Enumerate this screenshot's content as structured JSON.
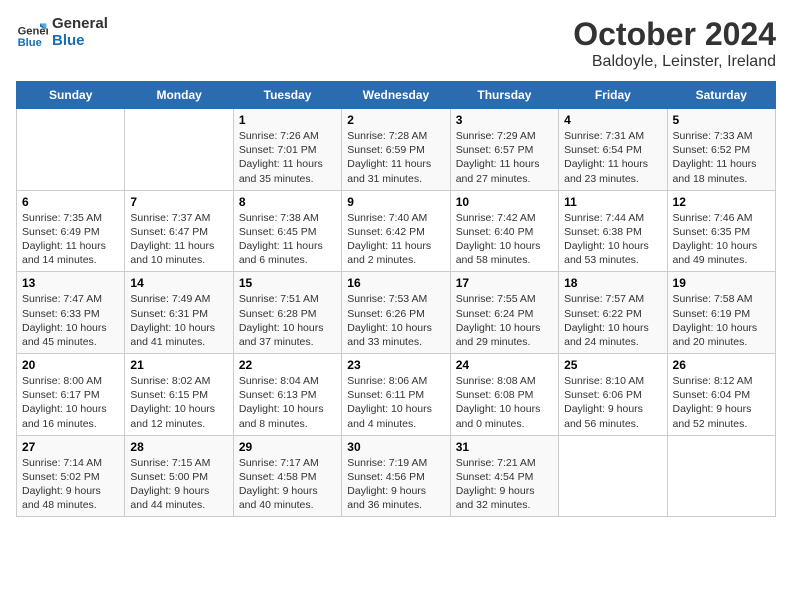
{
  "logo": {
    "line1": "General",
    "line2": "Blue"
  },
  "title": "October 2024",
  "subtitle": "Baldoyle, Leinster, Ireland",
  "headers": [
    "Sunday",
    "Monday",
    "Tuesday",
    "Wednesday",
    "Thursday",
    "Friday",
    "Saturday"
  ],
  "weeks": [
    [
      {
        "day": "",
        "detail": ""
      },
      {
        "day": "",
        "detail": ""
      },
      {
        "day": "1",
        "detail": "Sunrise: 7:26 AM\nSunset: 7:01 PM\nDaylight: 11 hours and 35 minutes."
      },
      {
        "day": "2",
        "detail": "Sunrise: 7:28 AM\nSunset: 6:59 PM\nDaylight: 11 hours and 31 minutes."
      },
      {
        "day": "3",
        "detail": "Sunrise: 7:29 AM\nSunset: 6:57 PM\nDaylight: 11 hours and 27 minutes."
      },
      {
        "day": "4",
        "detail": "Sunrise: 7:31 AM\nSunset: 6:54 PM\nDaylight: 11 hours and 23 minutes."
      },
      {
        "day": "5",
        "detail": "Sunrise: 7:33 AM\nSunset: 6:52 PM\nDaylight: 11 hours and 18 minutes."
      }
    ],
    [
      {
        "day": "6",
        "detail": "Sunrise: 7:35 AM\nSunset: 6:49 PM\nDaylight: 11 hours and 14 minutes."
      },
      {
        "day": "7",
        "detail": "Sunrise: 7:37 AM\nSunset: 6:47 PM\nDaylight: 11 hours and 10 minutes."
      },
      {
        "day": "8",
        "detail": "Sunrise: 7:38 AM\nSunset: 6:45 PM\nDaylight: 11 hours and 6 minutes."
      },
      {
        "day": "9",
        "detail": "Sunrise: 7:40 AM\nSunset: 6:42 PM\nDaylight: 11 hours and 2 minutes."
      },
      {
        "day": "10",
        "detail": "Sunrise: 7:42 AM\nSunset: 6:40 PM\nDaylight: 10 hours and 58 minutes."
      },
      {
        "day": "11",
        "detail": "Sunrise: 7:44 AM\nSunset: 6:38 PM\nDaylight: 10 hours and 53 minutes."
      },
      {
        "day": "12",
        "detail": "Sunrise: 7:46 AM\nSunset: 6:35 PM\nDaylight: 10 hours and 49 minutes."
      }
    ],
    [
      {
        "day": "13",
        "detail": "Sunrise: 7:47 AM\nSunset: 6:33 PM\nDaylight: 10 hours and 45 minutes."
      },
      {
        "day": "14",
        "detail": "Sunrise: 7:49 AM\nSunset: 6:31 PM\nDaylight: 10 hours and 41 minutes."
      },
      {
        "day": "15",
        "detail": "Sunrise: 7:51 AM\nSunset: 6:28 PM\nDaylight: 10 hours and 37 minutes."
      },
      {
        "day": "16",
        "detail": "Sunrise: 7:53 AM\nSunset: 6:26 PM\nDaylight: 10 hours and 33 minutes."
      },
      {
        "day": "17",
        "detail": "Sunrise: 7:55 AM\nSunset: 6:24 PM\nDaylight: 10 hours and 29 minutes."
      },
      {
        "day": "18",
        "detail": "Sunrise: 7:57 AM\nSunset: 6:22 PM\nDaylight: 10 hours and 24 minutes."
      },
      {
        "day": "19",
        "detail": "Sunrise: 7:58 AM\nSunset: 6:19 PM\nDaylight: 10 hours and 20 minutes."
      }
    ],
    [
      {
        "day": "20",
        "detail": "Sunrise: 8:00 AM\nSunset: 6:17 PM\nDaylight: 10 hours and 16 minutes."
      },
      {
        "day": "21",
        "detail": "Sunrise: 8:02 AM\nSunset: 6:15 PM\nDaylight: 10 hours and 12 minutes."
      },
      {
        "day": "22",
        "detail": "Sunrise: 8:04 AM\nSunset: 6:13 PM\nDaylight: 10 hours and 8 minutes."
      },
      {
        "day": "23",
        "detail": "Sunrise: 8:06 AM\nSunset: 6:11 PM\nDaylight: 10 hours and 4 minutes."
      },
      {
        "day": "24",
        "detail": "Sunrise: 8:08 AM\nSunset: 6:08 PM\nDaylight: 10 hours and 0 minutes."
      },
      {
        "day": "25",
        "detail": "Sunrise: 8:10 AM\nSunset: 6:06 PM\nDaylight: 9 hours and 56 minutes."
      },
      {
        "day": "26",
        "detail": "Sunrise: 8:12 AM\nSunset: 6:04 PM\nDaylight: 9 hours and 52 minutes."
      }
    ],
    [
      {
        "day": "27",
        "detail": "Sunrise: 7:14 AM\nSunset: 5:02 PM\nDaylight: 9 hours and 48 minutes."
      },
      {
        "day": "28",
        "detail": "Sunrise: 7:15 AM\nSunset: 5:00 PM\nDaylight: 9 hours and 44 minutes."
      },
      {
        "day": "29",
        "detail": "Sunrise: 7:17 AM\nSunset: 4:58 PM\nDaylight: 9 hours and 40 minutes."
      },
      {
        "day": "30",
        "detail": "Sunrise: 7:19 AM\nSunset: 4:56 PM\nDaylight: 9 hours and 36 minutes."
      },
      {
        "day": "31",
        "detail": "Sunrise: 7:21 AM\nSunset: 4:54 PM\nDaylight: 9 hours and 32 minutes."
      },
      {
        "day": "",
        "detail": ""
      },
      {
        "day": "",
        "detail": ""
      }
    ]
  ]
}
